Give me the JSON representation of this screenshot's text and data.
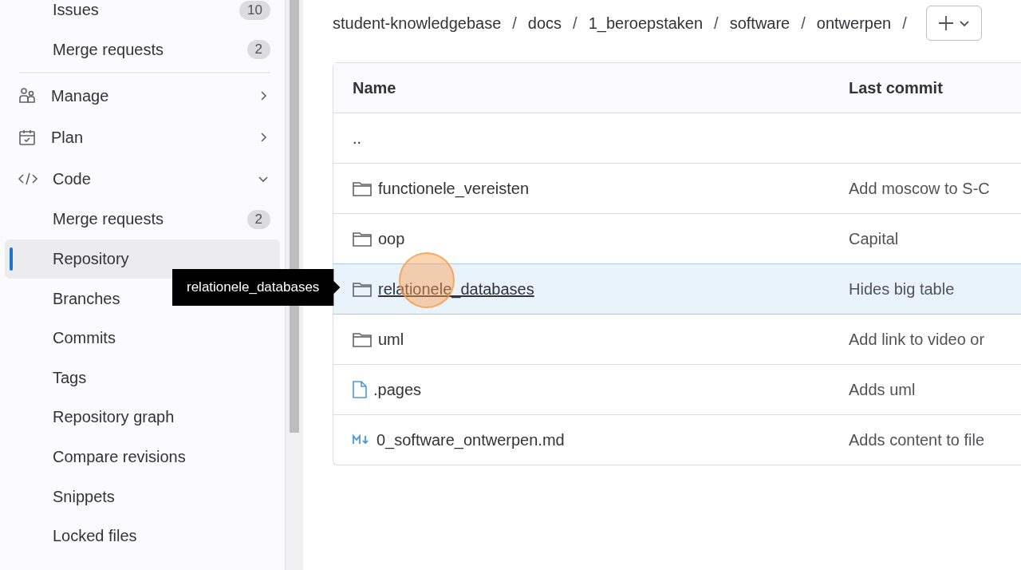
{
  "sidebar": {
    "items": [
      {
        "kind": "sub",
        "label": "Issues",
        "badge": "10",
        "selected": false
      },
      {
        "kind": "sub",
        "label": "Merge requests",
        "badge": "2",
        "selected": false
      },
      {
        "kind": "divider"
      },
      {
        "kind": "section",
        "label": "Manage",
        "expanded": false
      },
      {
        "kind": "section",
        "label": "Plan",
        "expanded": false
      },
      {
        "kind": "section",
        "label": "Code",
        "expanded": true
      },
      {
        "kind": "sub",
        "label": "Merge requests",
        "badge": "2",
        "selected": false
      },
      {
        "kind": "sub",
        "label": "Repository",
        "selected": true
      },
      {
        "kind": "sub",
        "label": "Branches",
        "selected": false
      },
      {
        "kind": "sub",
        "label": "Commits",
        "selected": false
      },
      {
        "kind": "sub",
        "label": "Tags",
        "selected": false
      },
      {
        "kind": "sub",
        "label": "Repository graph",
        "selected": false
      },
      {
        "kind": "sub",
        "label": "Compare revisions",
        "selected": false
      },
      {
        "kind": "sub",
        "label": "Snippets",
        "selected": false
      },
      {
        "kind": "sub",
        "label": "Locked files",
        "selected": false
      }
    ]
  },
  "breadcrumb": {
    "separator": "/",
    "items": [
      "student-knowledgebase",
      "docs",
      "1_beroepstaken",
      "software",
      "ontwerpen"
    ]
  },
  "table": {
    "columns": [
      "Name",
      "Last commit"
    ],
    "rows": [
      {
        "kind": "parent",
        "name": "..",
        "hovered": false
      },
      {
        "kind": "folder",
        "name": "functionele_vereisten",
        "commit": "Add moscow to S-C",
        "hovered": false
      },
      {
        "kind": "folder",
        "name": "oop",
        "commit": "Capital",
        "hovered": false
      },
      {
        "kind": "folder",
        "name": "relationele_databases",
        "commit": "Hides big table",
        "hovered": true
      },
      {
        "kind": "folder",
        "name": "uml",
        "commit": "Add link to video or",
        "hovered": false
      },
      {
        "kind": "file",
        "name": ".pages",
        "commit": "Adds uml",
        "hovered": false
      },
      {
        "kind": "markdown",
        "name": "0_software_ontwerpen.md",
        "commit": "Adds content to file",
        "hovered": false
      }
    ]
  },
  "tooltip": {
    "text": "relationele_databases"
  }
}
